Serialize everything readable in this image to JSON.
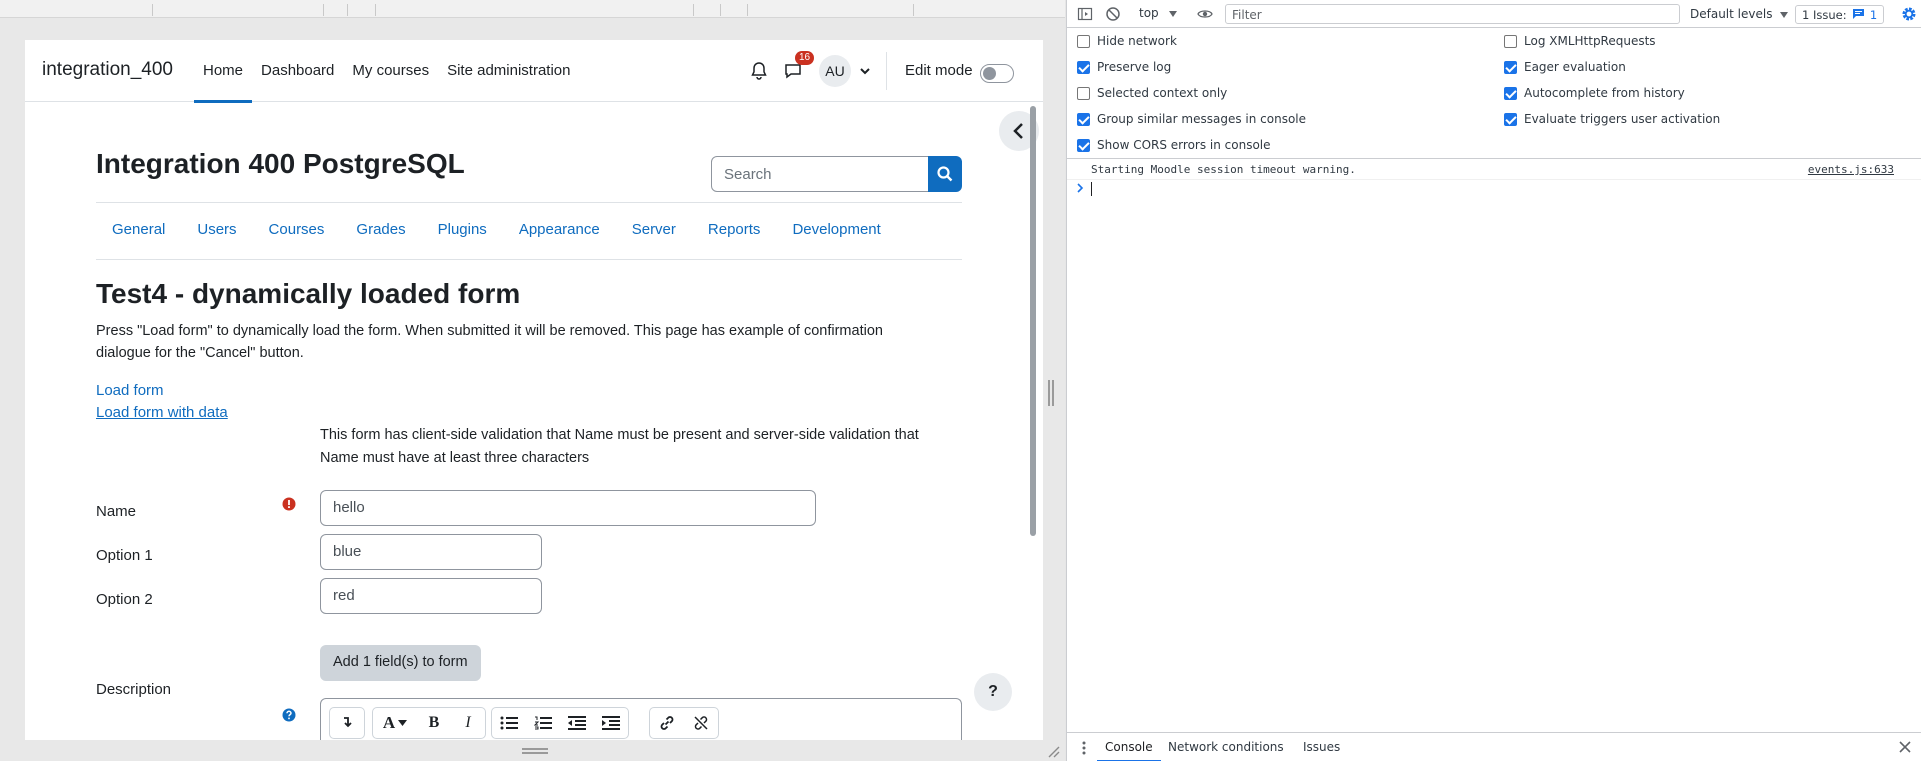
{
  "navbar": {
    "brand": "integration_400",
    "links": [
      "Home",
      "Dashboard",
      "My courses",
      "Site administration"
    ],
    "notification_count": "16",
    "avatar_initials": "AU",
    "edit_mode_label": "Edit mode"
  },
  "header": {
    "site_title": "Integration 400 PostgreSQL",
    "search_placeholder": "Search"
  },
  "admin_tabs": [
    "General",
    "Users",
    "Courses",
    "Grades",
    "Plugins",
    "Appearance",
    "Server",
    "Reports",
    "Development"
  ],
  "main": {
    "heading": "Test4 - dynamically loaded form",
    "intro": "Press \"Load form\" to dynamically load the form. When submitted it will be removed. This page has example of confirmation dialogue for the \"Cancel\" button.",
    "link_load_form": "Load form",
    "link_load_form_data": "Load form with data",
    "form_note": "This form has client-side validation that Name must be present and server-side validation that Name must have at least three characters",
    "fields": {
      "name_label": "Name",
      "name_value": "hello",
      "option1_label": "Option 1",
      "option1_value": "blue",
      "option2_label": "Option 2",
      "option2_value": "red",
      "add_button": "Add 1 field(s) to form",
      "description_label": "Description"
    },
    "help_button": "?"
  },
  "devtools": {
    "context": "top",
    "filter_placeholder": "Filter",
    "levels": "Default levels",
    "issues_label": "1 Issue:",
    "issues_count": "1",
    "settings_left": [
      {
        "label": "Hide network",
        "checked": false
      },
      {
        "label": "Preserve log",
        "checked": true
      },
      {
        "label": "Selected context only",
        "checked": false
      },
      {
        "label": "Group similar messages in console",
        "checked": true
      },
      {
        "label": "Show CORS errors in console",
        "checked": true
      }
    ],
    "settings_right": [
      {
        "label": "Log XMLHttpRequests",
        "checked": false
      },
      {
        "label": "Eager evaluation",
        "checked": true
      },
      {
        "label": "Autocomplete from history",
        "checked": true
      },
      {
        "label": "Evaluate triggers user activation",
        "checked": true
      }
    ],
    "console_message": "Starting Moodle session timeout warning.",
    "console_source": "events.js:633",
    "drawer_tabs": [
      "Console",
      "Network conditions",
      "Issues"
    ]
  },
  "colors": {
    "moodle_blue": "#0f6cbf",
    "error_red": "#ca3120",
    "devtools_blue": "#1a73e8"
  }
}
